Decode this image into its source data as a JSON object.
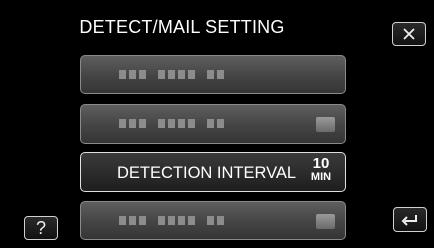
{
  "screen": {
    "title": "DETECT/MAIL SETTING"
  },
  "menu": {
    "items": [
      {
        "label": ""
      },
      {
        "label": ""
      },
      {
        "label": "DETECTION INTERVAL",
        "value": "10",
        "unit": "MIN"
      },
      {
        "label": ""
      }
    ]
  },
  "icons": {
    "close": "close-icon",
    "help": "help-icon",
    "back": "return-arrow-icon"
  },
  "colors": {
    "background": "#000000",
    "text": "#ffffff",
    "row_border": "#c8c8c8"
  }
}
